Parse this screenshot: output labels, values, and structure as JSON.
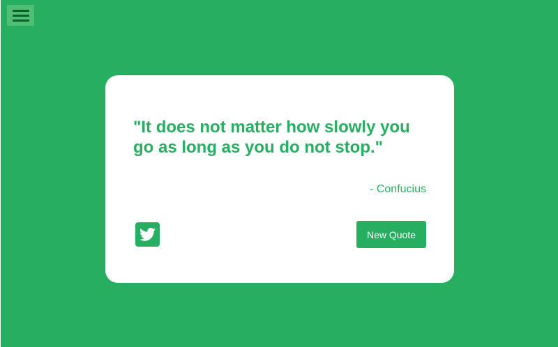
{
  "quote": {
    "text": "\"It does not matter how slowly you go as long as you do not stop.\"",
    "author": "- Confucius"
  },
  "actions": {
    "new_quote_label": "New Quote",
    "tweet_icon": "twitter-icon"
  },
  "menu": {
    "icon": "hamburger-menu-icon"
  },
  "colors": {
    "accent": "#27ae60",
    "card": "#ffffff",
    "menu_button_bg": "#4fbf73",
    "menu_icon": "#0e5f2c"
  }
}
